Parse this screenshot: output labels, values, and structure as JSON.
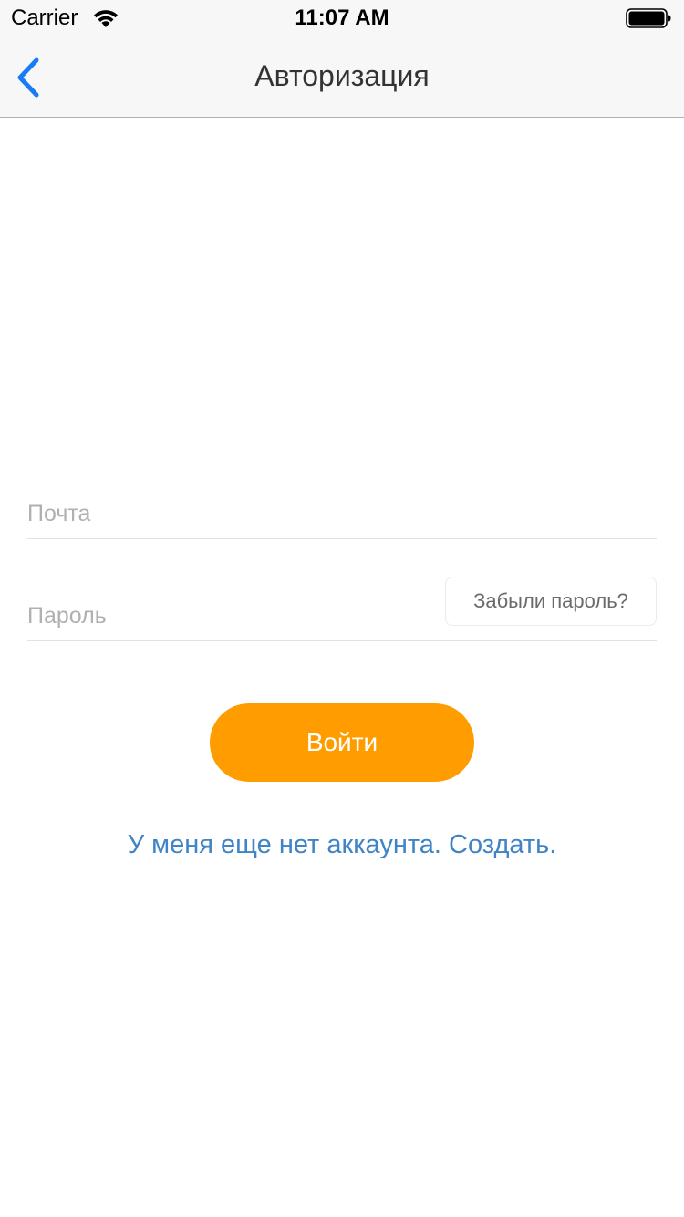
{
  "status_bar": {
    "carrier": "Carrier",
    "time": "11:07 AM",
    "icons": [
      "wifi-icon",
      "battery-icon"
    ]
  },
  "nav": {
    "title": "Авторизация",
    "back_icon": "chevron-left-icon",
    "accent_color": "#1a7cf4"
  },
  "form": {
    "email": {
      "value": "",
      "placeholder": "Почта"
    },
    "password": {
      "value": "",
      "placeholder": "Пароль"
    },
    "forgot_label": "Забыли пароль?",
    "login_label": "Войти",
    "signup_label": "У меня еще нет аккаунта. Создать."
  },
  "colors": {
    "primary_button": "#ff9d00",
    "link": "#3f84c6",
    "placeholder": "#b0b0b0"
  }
}
